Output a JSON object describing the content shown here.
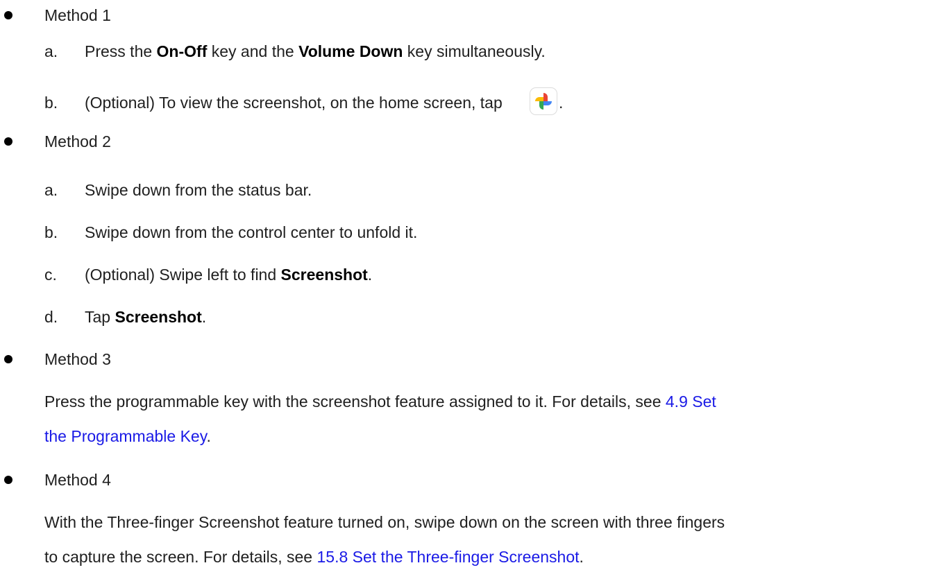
{
  "methods": [
    {
      "label": "Method 1"
    },
    {
      "label": "Method 2"
    },
    {
      "label": "Method 3"
    },
    {
      "label": "Method 4"
    }
  ],
  "m1": {
    "a_letter": "a.",
    "a_pre": "Press the ",
    "a_bold1": "On-Off",
    "a_mid": " key and the ",
    "a_bold2": "Volume Down",
    "a_post": " key simultaneously.",
    "b_letter": "b.",
    "b_text": "(Optional) To view the screenshot, on the home screen, tap",
    "b_post": ".",
    "icon": "google-photos-icon"
  },
  "m2": {
    "a_letter": "a.",
    "a_text": "Swipe down from the status bar.",
    "b_letter": "b.",
    "b_text": "Swipe down from the control center to unfold it.",
    "c_letter": "c.",
    "c_pre": "(Optional) Swipe left to find ",
    "c_bold": "Screenshot",
    "c_post": ".",
    "d_letter": "d.",
    "d_pre": "Tap ",
    "d_bold": "Screenshot",
    "d_post": "."
  },
  "m3": {
    "line1_pre": "Press the programmable key with the screenshot feature assigned to it. For details, see ",
    "link_part1": "4.9 Set",
    "link_part2": "the Programmable Key",
    "line2_post": "."
  },
  "m4": {
    "line1": "With the Three-finger Screenshot feature turned on, swipe down on the screen with three fingers",
    "line2_pre": "to capture the screen. For details, see ",
    "link": "15.8 Set the Three-finger Screenshot",
    "line2_post": "."
  },
  "colors": {
    "link": "#1a1ae6",
    "text": "#1f1f1f"
  }
}
